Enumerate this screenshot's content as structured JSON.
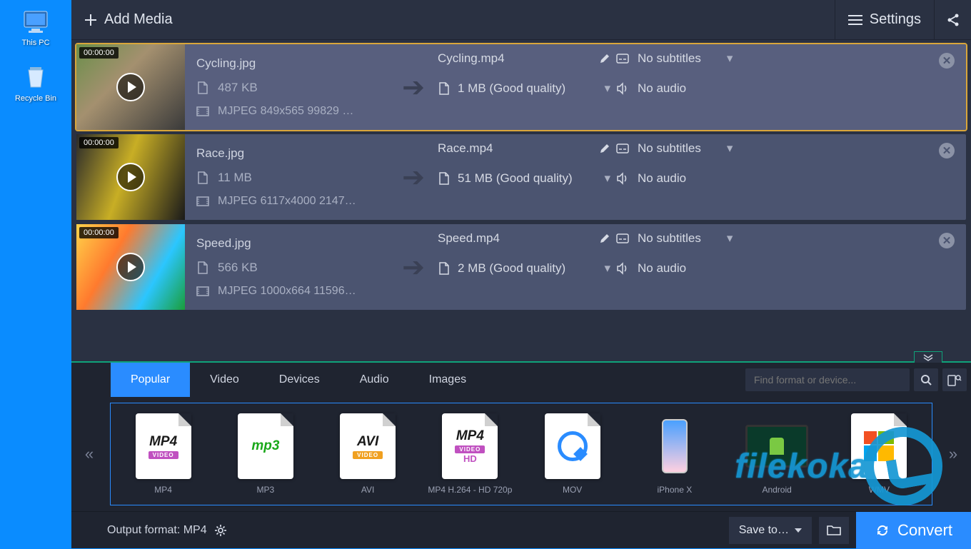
{
  "desktop": {
    "thispc": "This PC",
    "recycle": "Recycle Bin"
  },
  "topbar": {
    "add_media": "Add Media",
    "settings": "Settings"
  },
  "files": [
    {
      "timestamp": "00:00:00",
      "src_name": "Cycling.jpg",
      "src_size": "487 KB",
      "src_spec": "MJPEG 849x565 99829 …",
      "dst_name": "Cycling.mp4",
      "dst_size": "1 MB (Good quality)",
      "subtitles": "No subtitles",
      "audio": "No audio",
      "selected": true,
      "thumb_class": "t-cycling"
    },
    {
      "timestamp": "00:00:00",
      "src_name": "Race.jpg",
      "src_size": "11 MB",
      "src_spec": "MJPEG 6117x4000 2147…",
      "dst_name": "Race.mp4",
      "dst_size": "51 MB (Good quality)",
      "subtitles": "No subtitles",
      "audio": "No audio",
      "selected": false,
      "thumb_class": "t-race"
    },
    {
      "timestamp": "00:00:00",
      "src_name": "Speed.jpg",
      "src_size": "566 KB",
      "src_spec": "MJPEG 1000x664 11596…",
      "dst_name": "Speed.mp4",
      "dst_size": "2 MB (Good quality)",
      "subtitles": "No subtitles",
      "audio": "No audio",
      "selected": false,
      "thumb_class": "t-speed"
    }
  ],
  "tabs": {
    "popular": "Popular",
    "video": "Video",
    "devices": "Devices",
    "audio": "Audio",
    "images": "Images"
  },
  "search": {
    "placeholder": "Find format or device..."
  },
  "formats": [
    {
      "label": "MP4"
    },
    {
      "label": "MP3"
    },
    {
      "label": "AVI"
    },
    {
      "label": "MP4 H.264 - HD 720p"
    },
    {
      "label": "MOV"
    },
    {
      "label": "iPhone X"
    },
    {
      "label": "Android"
    },
    {
      "label": "WMV"
    }
  ],
  "bottom": {
    "output_label": "Output format: MP4",
    "saveto": "Save to…",
    "convert": "Convert"
  },
  "watermark": "filekoka"
}
